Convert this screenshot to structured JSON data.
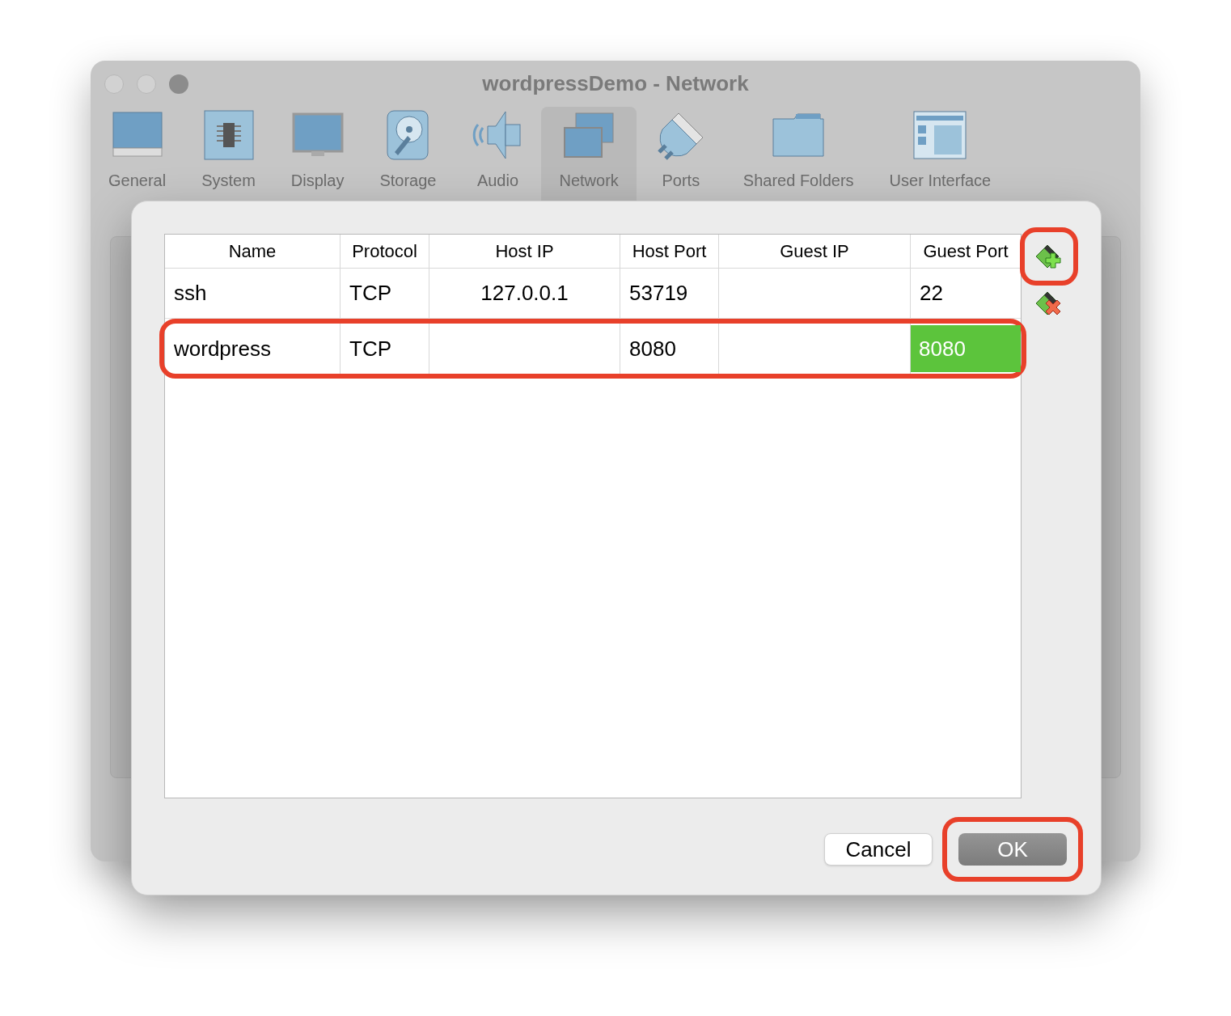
{
  "window": {
    "title": "wordpressDemo - Network"
  },
  "toolbar": [
    {
      "label": "General",
      "kind": "general",
      "selected": false
    },
    {
      "label": "System",
      "kind": "system",
      "selected": false
    },
    {
      "label": "Display",
      "kind": "display",
      "selected": false
    },
    {
      "label": "Storage",
      "kind": "storage",
      "selected": false
    },
    {
      "label": "Audio",
      "kind": "audio",
      "selected": false
    },
    {
      "label": "Network",
      "kind": "network",
      "selected": true
    },
    {
      "label": "Ports",
      "kind": "ports",
      "selected": false
    },
    {
      "label": "Shared Folders",
      "kind": "folders",
      "selected": false
    },
    {
      "label": "User Interface",
      "kind": "ui",
      "selected": false
    }
  ],
  "table": {
    "columns": [
      "Name",
      "Protocol",
      "Host IP",
      "Host Port",
      "Guest IP",
      "Guest Port"
    ],
    "rows": [
      {
        "highlighted": false,
        "cells": [
          {
            "text": "ssh",
            "active": false
          },
          {
            "text": "TCP",
            "active": false
          },
          {
            "text": "127.0.0.1",
            "active": false
          },
          {
            "text": "53719",
            "active": false
          },
          {
            "active": false
          },
          {
            "text": "22",
            "active": false
          }
        ]
      },
      {
        "highlighted": true,
        "cells": [
          {
            "text": "wordpress",
            "active": false
          },
          {
            "text": "TCP",
            "active": false
          },
          {
            "active": false
          },
          {
            "text": "8080",
            "active": false
          },
          {
            "active": false
          },
          {
            "text": "8080",
            "active": true
          }
        ]
      }
    ]
  },
  "side_buttons": [
    {
      "kind": "add",
      "highlighted": true
    },
    {
      "kind": "remove",
      "highlighted": false
    }
  ],
  "buttons": [
    {
      "label": "Cancel",
      "default": false,
      "highlighted": false
    },
    {
      "label": "OK",
      "default": true,
      "highlighted": true
    }
  ]
}
